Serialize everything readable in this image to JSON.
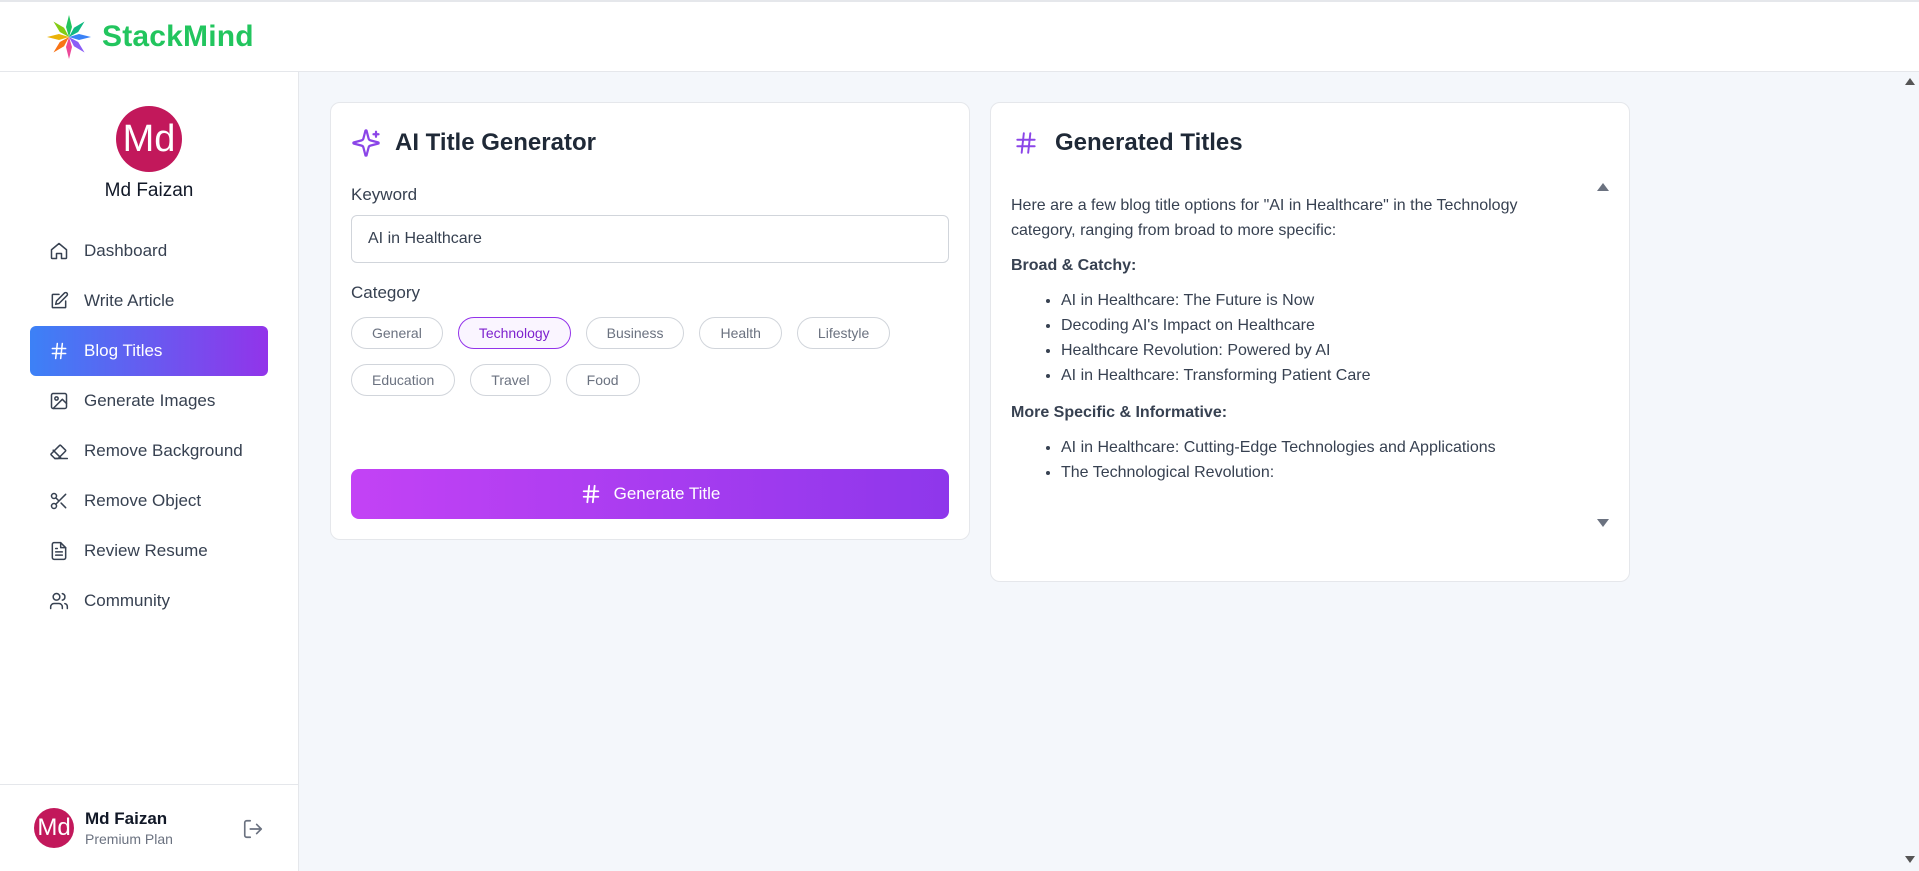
{
  "app": {
    "name": "StackMind",
    "brand_color": "#22c55e"
  },
  "user": {
    "initials": "Md",
    "name": "Md Faizan",
    "plan": "Premium Plan",
    "avatar_color": "#c2185b"
  },
  "sidebar": {
    "items": [
      {
        "label": "Dashboard",
        "icon": "home-icon",
        "active": false
      },
      {
        "label": "Write Article",
        "icon": "edit-icon",
        "active": false
      },
      {
        "label": "Blog Titles",
        "icon": "hash-icon",
        "active": true
      },
      {
        "label": "Generate Images",
        "icon": "image-icon",
        "active": false
      },
      {
        "label": "Remove Background",
        "icon": "eraser-icon",
        "active": false
      },
      {
        "label": "Remove Object",
        "icon": "scissors-icon",
        "active": false
      },
      {
        "label": "Review Resume",
        "icon": "file-text-icon",
        "active": false
      },
      {
        "label": "Community",
        "icon": "users-icon",
        "active": false
      }
    ]
  },
  "generator": {
    "title": "AI Title Generator",
    "keyword_label": "Keyword",
    "keyword_value": "AI in Healthcare",
    "category_label": "Category",
    "categories": [
      "General",
      "Technology",
      "Business",
      "Health",
      "Lifestyle",
      "Education",
      "Travel",
      "Food"
    ],
    "selected_category": "Technology",
    "button_label": "Generate Title"
  },
  "results": {
    "title": "Generated Titles",
    "intro": "Here are a few blog title options for \"AI in Healthcare\" in the Technology category, ranging from broad to more specific:",
    "sections": [
      {
        "heading": "Broad & Catchy:",
        "items": [
          "AI in Healthcare: The Future is Now",
          "Decoding AI's Impact on Healthcare",
          "Healthcare Revolution: Powered by AI",
          "AI in Healthcare: Transforming Patient Care"
        ]
      },
      {
        "heading": "More Specific & Informative:",
        "items": [
          "AI in Healthcare: Cutting-Edge Technologies and Applications",
          "The Technological Revolution:"
        ]
      }
    ]
  },
  "colors": {
    "accent_gradient_start": "#3c81f6",
    "accent_gradient_end": "#9234ea",
    "button_gradient_start": "#c342f5",
    "button_gradient_end": "#8e37eb"
  }
}
